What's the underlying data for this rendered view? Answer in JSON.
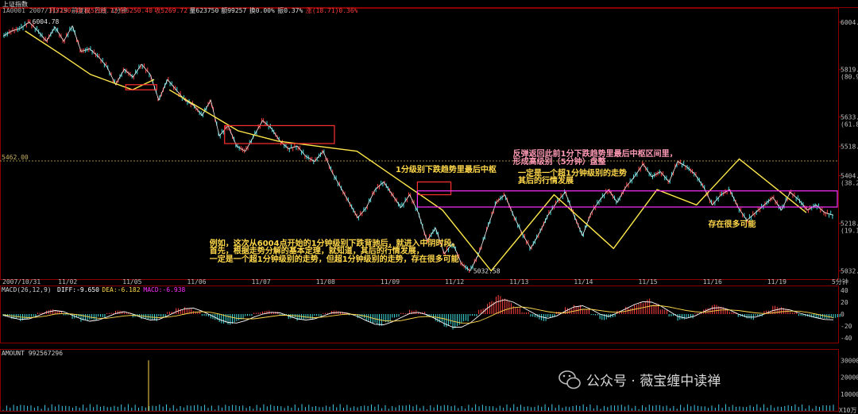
{
  "header": {
    "title": "上证指数",
    "subtitle": "1A0001 2007/11/19 前复权 日线 1分钟",
    "stats": [
      {
        "label": "开",
        "value": "5250.40",
        "color": "#ff3b3b"
      },
      {
        "label": "高",
        "value": "5269.72",
        "color": "#ff3b3b"
      },
      {
        "label": "低",
        "value": "5250.40",
        "color": "#ff3b3b"
      },
      {
        "label": "收",
        "value": "5269.72",
        "color": "#ff3b3b"
      },
      {
        "label": "量",
        "value": "623750",
        "color": "#dddddd"
      },
      {
        "label": "额",
        "value": "99257",
        "color": "#dddddd"
      },
      {
        "label": "换",
        "value": "0.00%",
        "color": "#dddddd"
      },
      {
        "label": "振",
        "value": "0.37%",
        "color": "#dddddd"
      },
      {
        "label": "涨",
        "value": "(18.71)0.36%",
        "color": "#ff3b3b"
      }
    ]
  },
  "chart_data": [
    {
      "type": "line",
      "name": "price",
      "ylim": [
        5000,
        6060
      ],
      "y_ticks": [
        {
          "v": 6004.8,
          "label": "6004.8",
          "sub": ""
        },
        {
          "v": 5819.1,
          "label": "5819.1",
          "sub": "(80.9%)"
        },
        {
          "v": 5633.4,
          "label": "5633.4",
          "sub": "(61.8%)"
        },
        {
          "v": 5518.7,
          "label": "5518.7",
          "sub": ""
        },
        {
          "v": 5404.0,
          "label": "5404.0",
          "sub": "(38.2%)"
        },
        {
          "v": 5218.3,
          "label": "5218.3",
          "sub": "(19.1%)"
        },
        {
          "v": 5032.6,
          "label": "5032.6",
          "sub": ""
        }
      ],
      "x_ticks": [
        "2007/10/31",
        "11/02",
        "11/05",
        "11/06",
        "11/07",
        "11/08",
        "11/09",
        "11/12",
        "11/13",
        "11/14",
        "11/15",
        "11/16",
        "11/19",
        "5分钟"
      ],
      "dashed_level": {
        "value": 5462.0,
        "label": "5462.00"
      },
      "high_label": "6004.78",
      "low_label": "5032.58",
      "series": [
        {
          "values": [
            5950,
            5970,
            5980,
            6004.8,
            5970,
            5930,
            5985,
            5930,
            5990,
            5890,
            5900,
            5870,
            5830,
            5760,
            5820,
            5790,
            5840,
            5800,
            5700,
            5780,
            5740,
            5700,
            5680,
            5640,
            5700,
            5560,
            5600,
            5520,
            5500,
            5560,
            5620,
            5590,
            5540,
            5510,
            5520,
            5480,
            5460,
            5500,
            5420,
            5360,
            5300,
            5240,
            5280,
            5350,
            5380,
            5330,
            5280,
            5330,
            5260,
            5150,
            5200,
            5100,
            5140,
            5060,
            5032.6,
            5100,
            5200,
            5300,
            5330,
            5250,
            5180,
            5120,
            5180,
            5250,
            5300,
            5340,
            5250,
            5170,
            5260,
            5310,
            5350,
            5300,
            5360,
            5400,
            5450,
            5400,
            5420,
            5380,
            5460,
            5440,
            5410,
            5360,
            5290,
            5330,
            5350,
            5280,
            5230,
            5260,
            5290,
            5320,
            5270,
            5340,
            5310,
            5270,
            5290,
            5260,
            5250
          ]
        }
      ],
      "stroke_lines": [
        [
          [
            3.0,
            5970
          ],
          [
            7.2,
            5880
          ],
          [
            10.8,
            5800
          ],
          [
            15.8,
            5740
          ],
          [
            18.4,
            5780
          ]
        ],
        [
          [
            20.2,
            5740
          ],
          [
            28.4,
            5580
          ],
          [
            33.1,
            5540
          ],
          [
            42.6,
            5500
          ],
          [
            52.8,
            5270
          ],
          [
            58.6,
            5032.6
          ],
          [
            66.1,
            5330
          ],
          [
            73.2,
            5120
          ],
          [
            78.4,
            5350
          ],
          [
            83.1,
            5290
          ],
          [
            88.2,
            5470
          ],
          [
            96.2,
            5260
          ]
        ]
      ],
      "boxes": [
        {
          "color": "#ff3030",
          "x0": 15.0,
          "x1": 18.7,
          "y0": 5740,
          "y1": 5760
        },
        {
          "color": "#ff3030",
          "x0": 26.8,
          "x1": 39.9,
          "y0": 5530,
          "y1": 5600
        },
        {
          "color": "#ff3030",
          "x0": 49.8,
          "x1": 53.8,
          "y0": 5330,
          "y1": 5380
        },
        {
          "color": "#ff30ff",
          "x0": 49.8,
          "x1": 100.0,
          "y0": 5282,
          "y1": 5345
        }
      ],
      "annotations": [
        {
          "text": "1分级别下跌趋势里最后中枢",
          "x": 47.2,
          "y": 5418,
          "color": "#ffd84a"
        },
        {
          "text": "反弹返回此前1分下跌趋势里最后中枢区间里，",
          "x": 61.2,
          "y": 5480,
          "color": "#ff9ab5"
        },
        {
          "text": "形成高级别（5分钟）盘整",
          "x": 61.2,
          "y": 5450,
          "color": "#ff9ab5"
        },
        {
          "text": "一定是一个超1分钟级别的走势",
          "x": 61.8,
          "y": 5405,
          "color": "#ffd84a"
        },
        {
          "text": "其后的行情发展",
          "x": 61.8,
          "y": 5375,
          "color": "#ffd84a"
        },
        {
          "text": "存在很多可能",
          "x": 84.5,
          "y": 5205,
          "color": "#ffd84a"
        },
        {
          "text": "例如，这次从6004点开始的1分钟级别下跌背驰后，就进入中阴时段。",
          "x": 25.0,
          "y": 5130,
          "color": "#ffd84a"
        },
        {
          "text": "首先，根据走势分解的基本定理，就知道，其后的行情发展，",
          "x": 25.0,
          "y": 5100,
          "color": "#ffd84a"
        },
        {
          "text": "一定是一个超1分钟级别的走势，但超1分钟级别的走势，存在很多可能",
          "x": 25.0,
          "y": 5068,
          "color": "#ffd84a"
        }
      ]
    },
    {
      "type": "bar",
      "name": "MACD",
      "title": "MACD(26,12,9)",
      "legend": [
        {
          "text": "DIFF:-9.650",
          "color": "#ffffff"
        },
        {
          "text": "DEA:-6.182",
          "color": "#ffd84a"
        },
        {
          "text": "MACD:-6.938",
          "color": "#ff30ff"
        }
      ],
      "ylim": [
        -48,
        48
      ],
      "y_ticks": [
        40.0,
        20.0,
        0.0,
        -20.0,
        -40.0
      ],
      "macd": [
        -4,
        -8,
        -12,
        -6,
        3,
        8,
        6,
        -2,
        -8,
        -14,
        -12,
        -6,
        2,
        6,
        3,
        -6,
        -10,
        -12,
        -5,
        4,
        10,
        12,
        6,
        -4,
        -10,
        -16,
        -18,
        -12,
        -4,
        3,
        6,
        4,
        -3,
        -8,
        -12,
        -10,
        -4,
        2,
        6,
        4,
        -2,
        -8,
        -16,
        -20,
        -14,
        -6,
        2,
        8,
        4,
        -6,
        -14,
        -22,
        -26,
        -16,
        -4,
        10,
        22,
        32,
        26,
        14,
        4,
        -6,
        -12,
        -6,
        4,
        12,
        18,
        10,
        -2,
        -10,
        -6,
        6,
        14,
        22,
        26,
        18,
        8,
        -4,
        -12,
        -8,
        2,
        10,
        16,
        12,
        4,
        -6,
        -10,
        -4,
        6,
        14,
        12,
        4,
        -4,
        -6,
        -7,
        -8,
        -7
      ],
      "diff": [
        -2,
        -6,
        -9,
        -8,
        -3,
        3,
        6,
        4,
        -2,
        -8,
        -12,
        -10,
        -5,
        1,
        4,
        0,
        -6,
        -10,
        -9,
        -3,
        4,
        9,
        10,
        5,
        -2,
        -9,
        -14,
        -15,
        -11,
        -5,
        0,
        3,
        2,
        -3,
        -8,
        -10,
        -8,
        -3,
        2,
        3,
        1,
        -4,
        -11,
        -17,
        -18,
        -13,
        -6,
        1,
        3,
        -1,
        -8,
        -16,
        -22,
        -22,
        -15,
        -3,
        10,
        20,
        24,
        20,
        12,
        4,
        -4,
        -7,
        -3,
        5,
        12,
        14,
        8,
        0,
        -4,
        2,
        9,
        16,
        21,
        20,
        14,
        5,
        -4,
        -7,
        -3,
        4,
        10,
        11,
        7,
        0,
        -5,
        -5,
        0,
        6,
        9,
        7,
        2,
        -2,
        -6,
        -9,
        -9.65
      ],
      "dea": [
        -1,
        -3,
        -5,
        -6,
        -5,
        -3,
        0,
        1,
        0,
        -2,
        -5,
        -7,
        -7,
        -5,
        -3,
        -2,
        -3,
        -5,
        -6,
        -5,
        -3,
        0,
        3,
        4,
        3,
        0,
        -4,
        -7,
        -8,
        -8,
        -6,
        -4,
        -2,
        -2,
        -3,
        -5,
        -6,
        -5,
        -3,
        -1,
        0,
        -1,
        -4,
        -8,
        -11,
        -12,
        -11,
        -8,
        -5,
        -4,
        -5,
        -8,
        -12,
        -15,
        -15,
        -12,
        -6,
        1,
        7,
        11,
        12,
        10,
        7,
        4,
        2,
        2,
        5,
        8,
        8,
        6,
        4,
        3,
        5,
        8,
        11,
        14,
        14,
        12,
        9,
        6,
        4,
        3,
        5,
        7,
        7,
        6,
        4,
        2,
        1,
        2,
        4,
        5,
        5,
        3,
        0,
        -3,
        -6.18
      ]
    },
    {
      "type": "bar",
      "name": "AMOUNT",
      "title": "AMOUNT 992567296",
      "ylim": [
        0,
        320000
      ],
      "y_ticks": [
        {
          "v": 300000,
          "label": "300000"
        },
        {
          "v": 200000,
          "label": "200000"
        },
        {
          "v": 100000,
          "label": "100000"
        }
      ],
      "unit_label": "X10万",
      "spike_index": 17,
      "spike_value": 300000
    }
  ],
  "watermark": {
    "text": "公众号 · 薇宝缠中读禅"
  }
}
